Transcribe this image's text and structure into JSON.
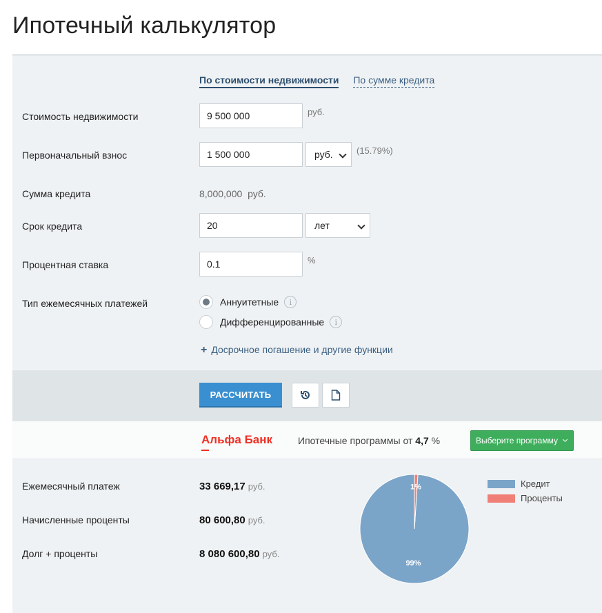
{
  "title": "Ипотечный калькулятор",
  "mode_tabs": [
    {
      "label": "По стоимости недвижимости",
      "active": true
    },
    {
      "label": "По сумме кредита",
      "active": false
    }
  ],
  "form": {
    "property_cost": {
      "label": "Стоимость недвижимости",
      "value": "9 500 000",
      "unit": "руб."
    },
    "down_payment": {
      "label": "Первоначальный взнос",
      "value": "1 500 000",
      "unit_select": "руб.",
      "percent": "(15.79%)"
    },
    "loan_amount": {
      "label": "Сумма кредита",
      "value": "8,000,000",
      "unit": "руб."
    },
    "term": {
      "label": "Срок кредита",
      "value": "20",
      "unit_select": "лет"
    },
    "rate": {
      "label": "Процентная ставка",
      "value": "0.1",
      "unit": "%"
    },
    "payment_type": {
      "label": "Тип ежемесячных платежей",
      "options": [
        {
          "label": "Аннуитетные",
          "checked": true
        },
        {
          "label": "Дифференцированные",
          "checked": false
        }
      ]
    },
    "extra_link": "Досрочное погашение и другие функции"
  },
  "actions": {
    "calculate_label": "РАССЧИТАТЬ",
    "reset_icon": "history-icon",
    "export_icon": "document-icon"
  },
  "promo": {
    "bank_name": "Альфа Банк",
    "text_before": "Ипотечные программы от",
    "rate": "4,7",
    "rate_unit": "%",
    "button_label": "Выберите программу"
  },
  "results": {
    "monthly_payment": {
      "label": "Ежемесячный платеж",
      "value": "33 669,17",
      "unit": "руб."
    },
    "interest_total": {
      "label": "Начисленные проценты",
      "value": "80 600,80",
      "unit": "руб."
    },
    "total": {
      "label": "Долг + проценты",
      "value": "8 080 600,80",
      "unit": "руб."
    }
  },
  "chart_data": {
    "type": "pie",
    "slices": [
      {
        "name": "Кредит",
        "value": 99,
        "label": "99%",
        "color": "#7ba4c9"
      },
      {
        "name": "Проценты",
        "value": 1,
        "label": "1%",
        "color": "#f08077"
      }
    ]
  }
}
